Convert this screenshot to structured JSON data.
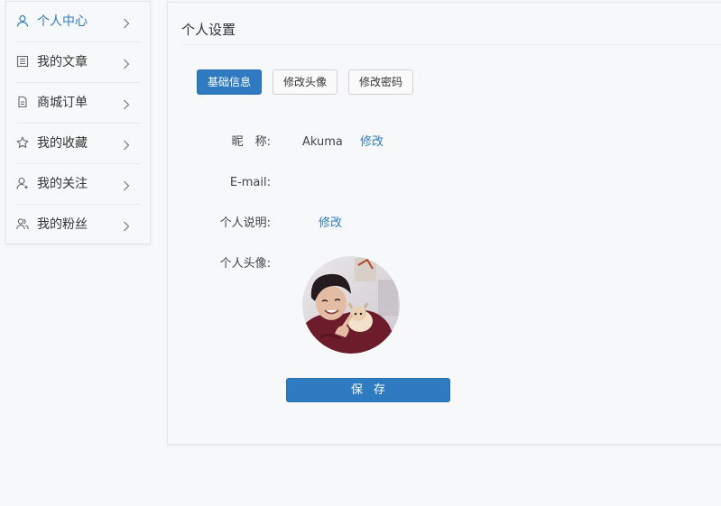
{
  "sidebar": {
    "items": [
      {
        "label": "个人中心",
        "icon": "user-icon",
        "active": true
      },
      {
        "label": "我的文章",
        "icon": "list-icon",
        "active": false
      },
      {
        "label": "商城订单",
        "icon": "document-icon",
        "active": false
      },
      {
        "label": "我的收藏",
        "icon": "star-icon",
        "active": false
      },
      {
        "label": "我的关注",
        "icon": "user-add-icon",
        "active": false
      },
      {
        "label": "我的粉丝",
        "icon": "users-icon",
        "active": false
      }
    ]
  },
  "panel": {
    "title": "个人设置",
    "tabs": [
      {
        "label": "基础信息",
        "active": true
      },
      {
        "label": "修改头像",
        "active": false
      },
      {
        "label": "修改密码",
        "active": false
      }
    ],
    "fields": {
      "nickname": {
        "label": "昵　称:",
        "value": "Akuma",
        "action": "修改"
      },
      "email": {
        "label": "E-mail:",
        "value": ""
      },
      "bio": {
        "label": "个人说明:",
        "value": "",
        "action": "修改"
      },
      "avatar": {
        "label": "个人头像:"
      }
    },
    "save_label": "保存"
  },
  "colors": {
    "accent": "#2f7bc1",
    "background": "#f7f8f9"
  }
}
